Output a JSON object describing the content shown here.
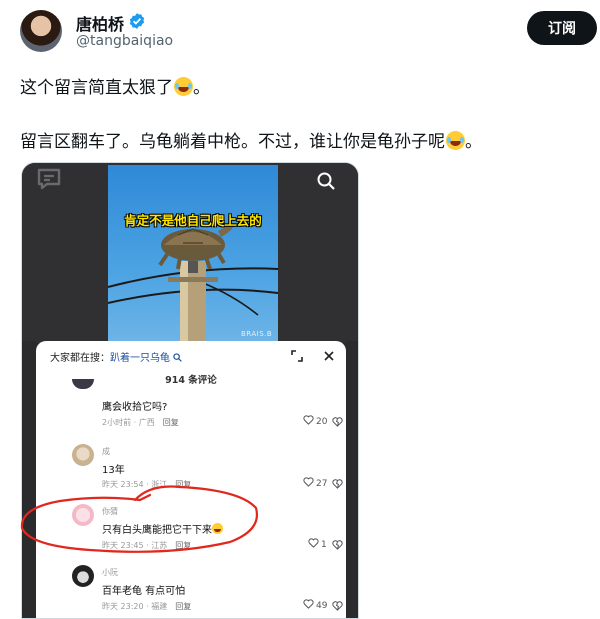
{
  "post": {
    "author_name": "唐柏桥",
    "handle": "@tangbaiqiao",
    "subscribe_label": "订阅",
    "line1": "这个留言简直太狠了",
    "line1_suffix": "。",
    "line2": "留言区翻车了。乌龟躺着中枪。不过，谁让你是龟孙子呢",
    "line2_suffix": "。"
  },
  "screenshot": {
    "video_caption": "肯定不是他自己爬上去的",
    "video_watermark": "BRAIS.B",
    "search_prefix": "大家都在搜：",
    "search_keyword": "趴着一只乌龟",
    "comment_count": "914 条评论",
    "comments": [
      {
        "user": "",
        "text": "鹰会收拾它吗?",
        "meta": "2小时前 · 广西",
        "reply": "回复",
        "likes": "20"
      },
      {
        "user": "成",
        "text": "13年",
        "meta": "昨天 23:54 · 浙江",
        "reply": "回复",
        "likes": "27"
      },
      {
        "user": "你猜",
        "text": "只有白头鹰能把它干下来",
        "meta": "昨天 23:45 · 江苏",
        "reply": "回复",
        "likes": "1"
      },
      {
        "user": "小阮",
        "text": "百年老龟 有点可怕",
        "meta": "昨天 23:20 · 福建",
        "reply": "回复",
        "likes": "49"
      }
    ]
  },
  "colors": {
    "verified_blue": "#1d9bf0",
    "annotation_red": "#e0281e",
    "button_dark": "#0f1419"
  },
  "icons": [
    "verified-icon",
    "chat-icon",
    "search-icon",
    "expand-icon",
    "close-icon",
    "heart-icon",
    "dislike-icon",
    "laughing-emoji"
  ]
}
